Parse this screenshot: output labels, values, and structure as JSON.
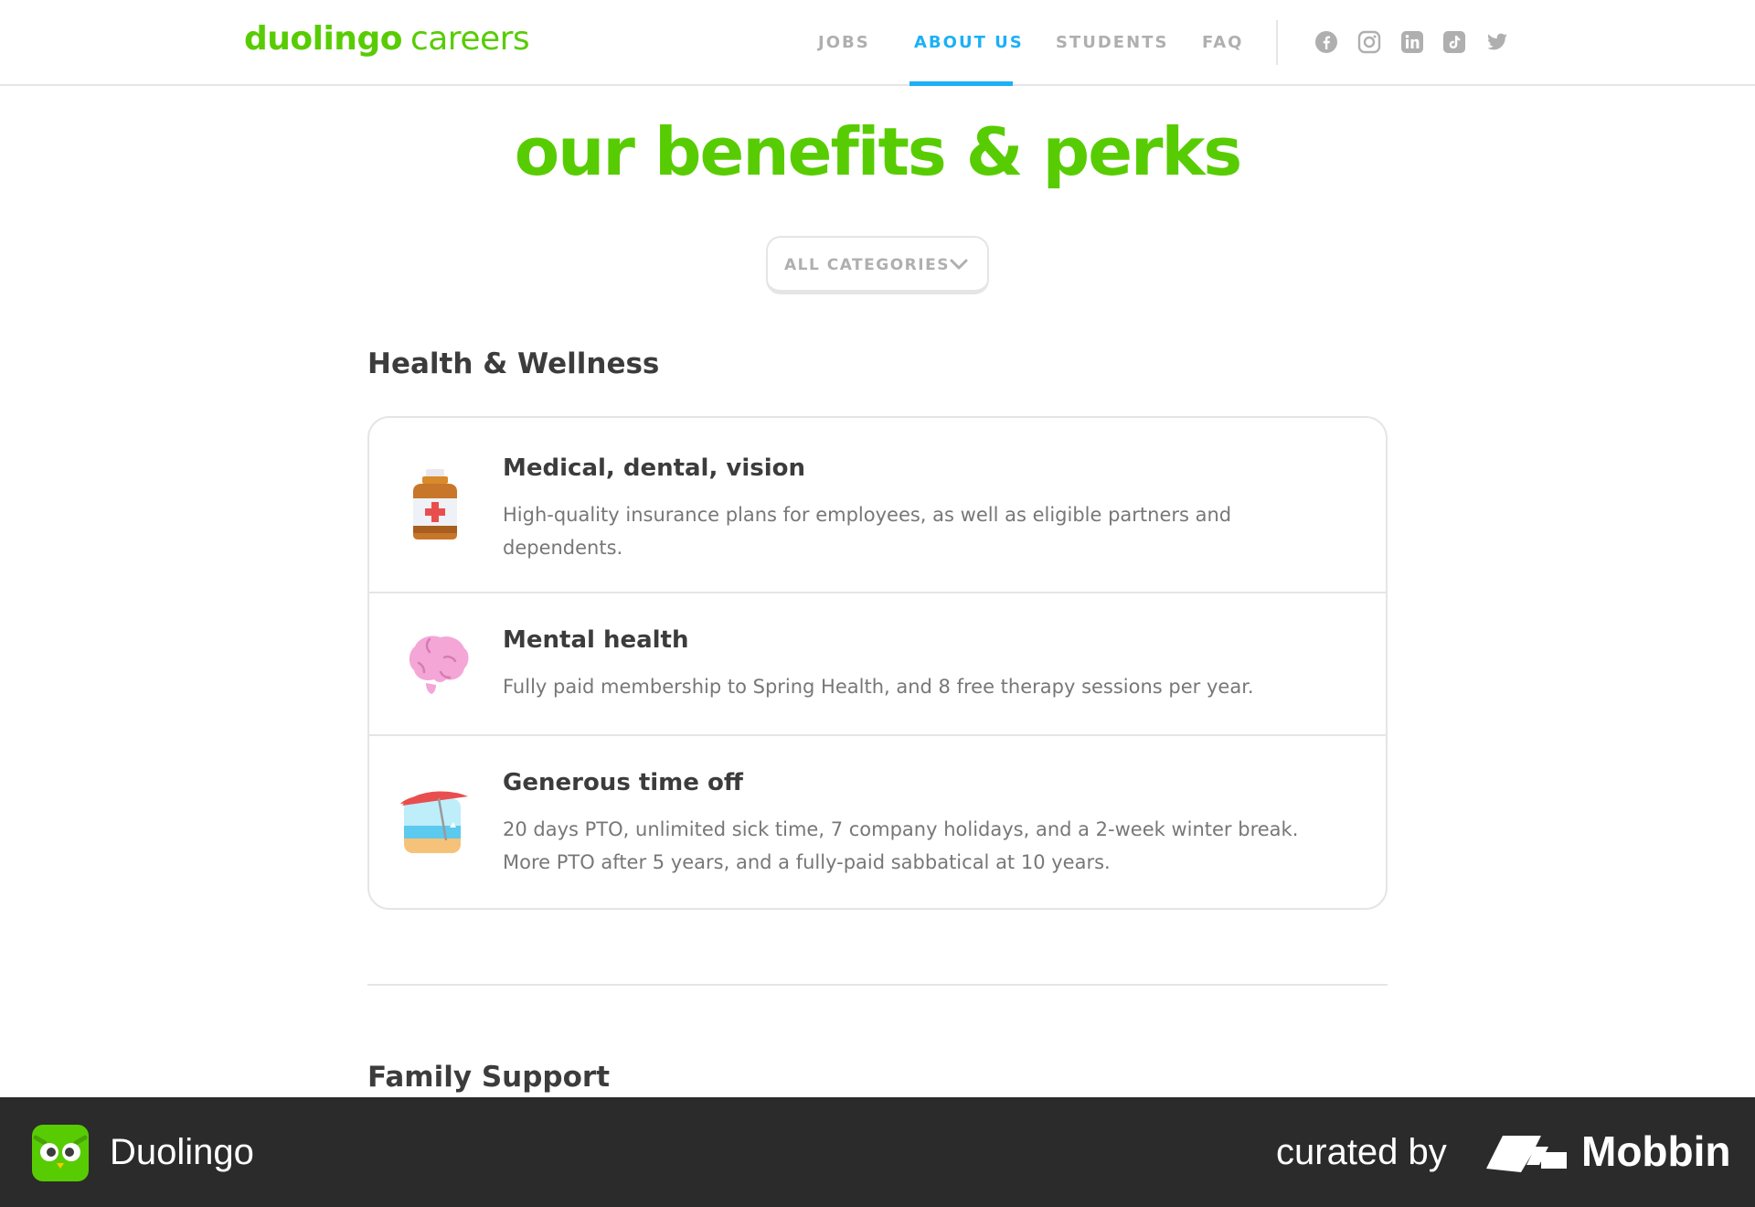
{
  "header": {
    "logo_wordmark": "duolingo",
    "logo_suffix": "careers",
    "nav": [
      {
        "label": "JOBS",
        "active": false
      },
      {
        "label": "ABOUT US",
        "active": true
      },
      {
        "label": "STUDENTS",
        "active": false
      },
      {
        "label": "FAQ",
        "active": false
      }
    ],
    "social_icons": [
      "facebook-icon",
      "instagram-icon",
      "linkedin-icon",
      "tiktok-icon",
      "twitter-icon"
    ]
  },
  "page_title": "our benefits & perks",
  "filter": {
    "label": "ALL CATEGORIES"
  },
  "sections": [
    {
      "heading": "Health & Wellness",
      "benefits": [
        {
          "icon": "medicine-bottle-icon",
          "title": "Medical, dental, vision",
          "description": "High-quality insurance plans for employees, as well as eligible partners and dependents."
        },
        {
          "icon": "brain-icon",
          "title": "Mental health",
          "description": "Fully paid membership to Spring Health, and 8 free therapy sessions per year."
        },
        {
          "icon": "beach-umbrella-icon",
          "title": "Generous time off",
          "description": "20 days PTO, unlimited sick time, 7 company holidays, and a 2-week winter break. More PTO after 5 years, and a fully-paid sabbatical at 10 years."
        }
      ]
    },
    {
      "heading": "Family Support"
    }
  ],
  "footer": {
    "app_name": "Duolingo",
    "curated_by": "curated by",
    "brand": "Mobbin"
  },
  "colors": {
    "brand_green": "#58cc02",
    "accent_blue": "#1cb0f6",
    "text_dark": "#3c3c3c",
    "text_muted": "#777777",
    "nav_gray": "#afafaf",
    "border": "#e5e5e5",
    "footer_bg": "#2b2b2b"
  }
}
